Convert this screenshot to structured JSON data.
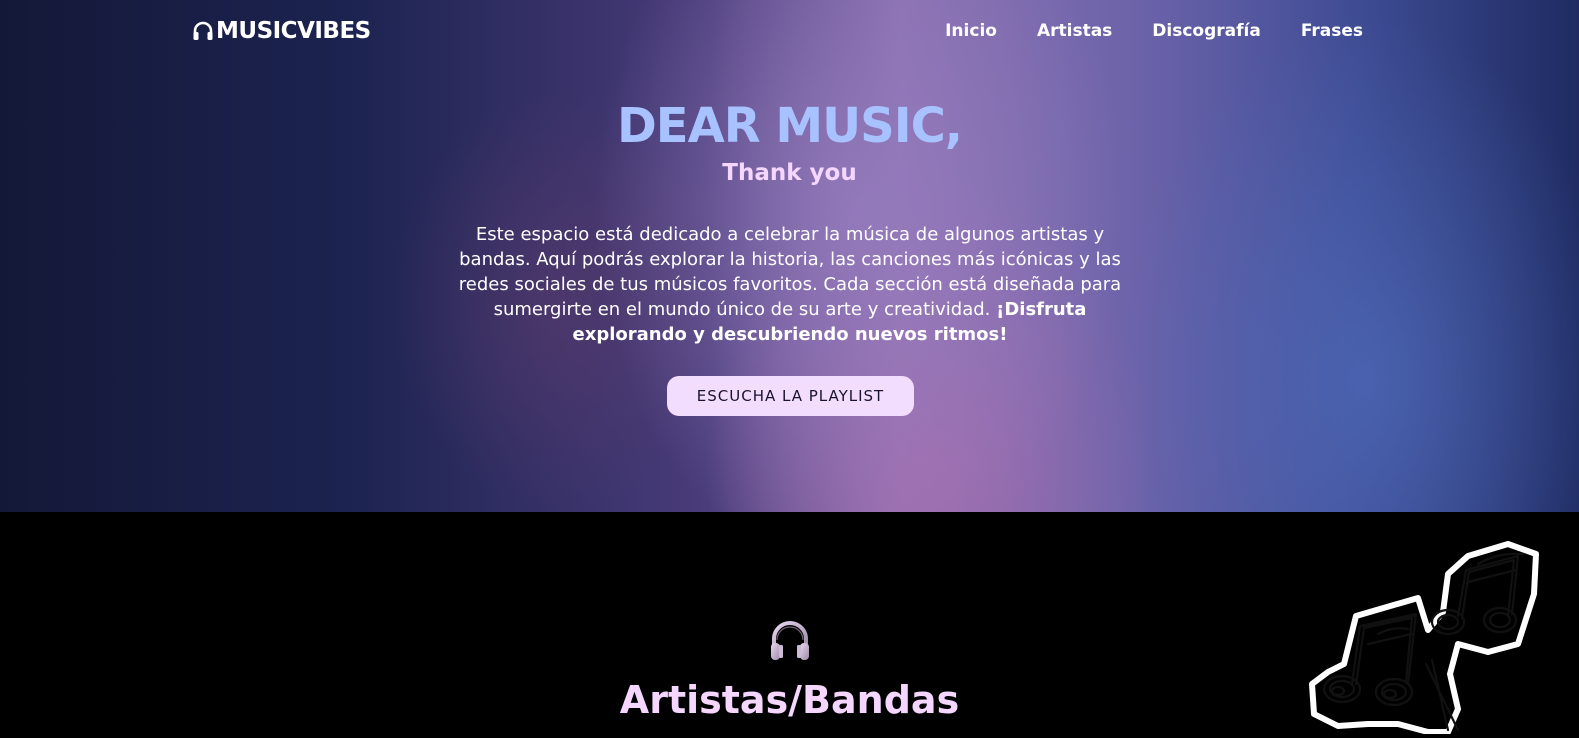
{
  "header": {
    "brand": "MUSICVIBES",
    "nav": [
      "Inicio",
      "Artistas",
      "Discografía",
      "Frases"
    ]
  },
  "hero": {
    "title": "DEAR MUSIC,",
    "subtitle": "Thank you",
    "text": "Este espacio está dedicado a celebrar la música de algunos artistas y bandas. Aquí podrás explorar la historia, las canciones más icónicas y las redes sociales de tus músicos favoritos. Cada sección está diseñada para sumergirte en el mundo único de su arte y creatividad.",
    "text_bold": "¡Disfruta explorando y descubriendo nuevos ritmos!",
    "button": "ESCUCHA LA PLAYLIST"
  },
  "artists_section": {
    "title": "Artistas/Bandas"
  },
  "colors": {
    "title": "#a8c2ff",
    "subtitle": "#f4d6ff",
    "button_bg": "#f3ddff",
    "section_bg": "#000000"
  },
  "icons": [
    "headphones-icon",
    "music-notes-doodle"
  ]
}
